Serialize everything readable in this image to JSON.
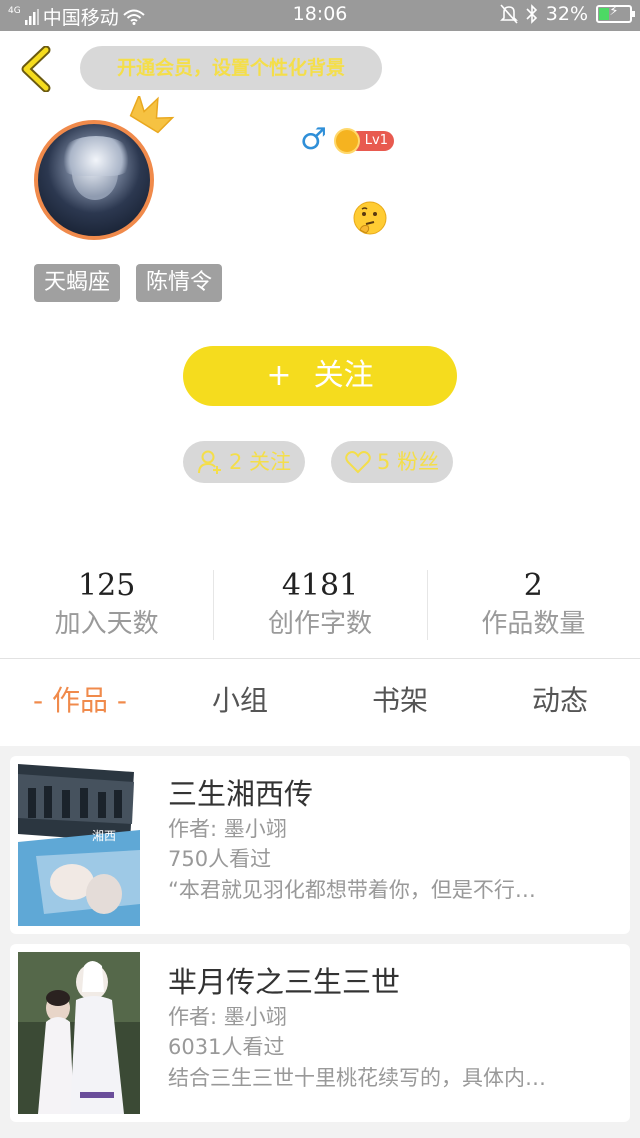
{
  "status_bar": {
    "network": "4G",
    "carrier": "中国移动",
    "time": "18:06",
    "battery_percent": "32%",
    "battery_level": 0.32
  },
  "header": {
    "vip_banner": "开通会员，设置个性化背景"
  },
  "profile": {
    "gender_symbol": "♂",
    "level": "Lv1",
    "tags": [
      "天蝎座",
      "陈情令"
    ],
    "follow_button": {
      "icon": "+",
      "label": "关注"
    },
    "following": "2 关注",
    "followers": "5 粉丝"
  },
  "stats": [
    {
      "value": "125",
      "label": "加入天数"
    },
    {
      "value": "4181",
      "label": "创作字数"
    },
    {
      "value": "2",
      "label": "作品数量"
    }
  ],
  "tabs": [
    "- 作品 -",
    "小组",
    "书架",
    "动态"
  ],
  "works": [
    {
      "title": "三生湘西传",
      "author": "作者: 墨小翊",
      "views": "750人看过",
      "excerpt": "“本君就见羽化都想带着你，但是不行…"
    },
    {
      "title": "芈月传之三生三世",
      "author": "作者: 墨小翊",
      "views": "6031人看过",
      "excerpt": "结合三生三世十里桃花续写的，具体内…"
    }
  ],
  "colors": {
    "accent_orange": "#f08a4b",
    "follow_yellow": "#f5dc1e",
    "status_gray": "#9a9a9a",
    "pill_gray": "#d8d8d8",
    "level_red": "#e85a4f"
  }
}
